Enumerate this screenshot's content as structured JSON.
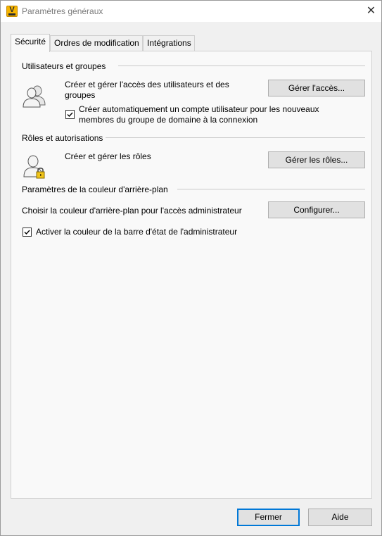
{
  "window": {
    "title": "Paramètres généraux",
    "app_icon_letter": "V",
    "close_glyph": "✕"
  },
  "tabs": [
    {
      "label": "Sécurité",
      "active": true
    },
    {
      "label": "Ordres de modification",
      "active": false
    },
    {
      "label": "Intégrations",
      "active": false
    }
  ],
  "sections": {
    "users": {
      "header": "Utilisateurs et groupes",
      "description": "Créer et gérer l'accès des utilisateurs et des groupes",
      "desc_line1": "Créer et gérer l'accès des utilisateurs et des",
      "desc_line2": "groupes",
      "button": "Gérer l'accès...",
      "icon": "users-group-icon",
      "checkbox_line1": "Créer automatiquement un compte utilisateur pour les nouveaux",
      "checkbox_line2": "membres du groupe de domaine à la connexion",
      "checkbox_checked": true
    },
    "roles": {
      "header": "Rôles et autorisations",
      "description": "Créer et gérer les rôles",
      "button": "Gérer les rôles...",
      "icon": "user-lock-icon"
    },
    "background": {
      "header": "Paramètres de la couleur d'arrière-plan",
      "description": "Choisir la couleur d'arrière-plan pour l'accès administrateur",
      "button": "Configurer...",
      "checkbox_label": "Activer la couleur de la barre d'état de l'administrateur",
      "checkbox_checked": true
    }
  },
  "footer": {
    "close_button": "Fermer",
    "help_button": "Aide"
  },
  "colors": {
    "window_bg": "#f0f0f0",
    "panel_bg": "#f9f9f9",
    "accent": "#0078d7",
    "app_icon": "#f5b400"
  }
}
